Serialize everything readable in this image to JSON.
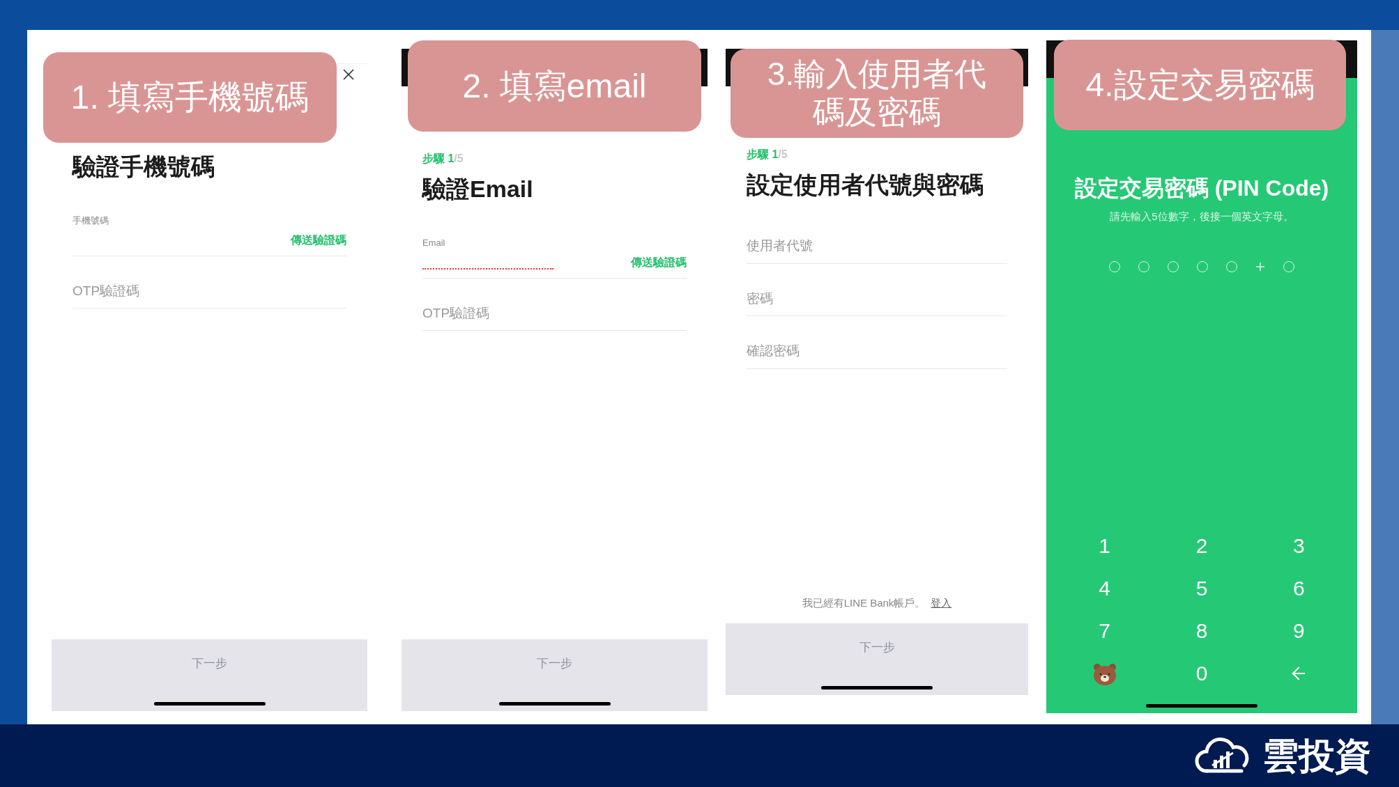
{
  "panels": [
    {
      "kind": "form",
      "caption": "1. 填寫手機號碼",
      "dark_top_bar": false,
      "closable": true,
      "title": "驗證手機號碼",
      "fields": [
        {
          "label": "手機號碼",
          "action": "傳送驗證碼",
          "redacted": false
        },
        {
          "placeholder": "OTP驗證碼"
        }
      ],
      "next_button": "下一步"
    },
    {
      "kind": "form",
      "caption": "2. 填寫email",
      "dark_top_bar": true,
      "closable": false,
      "step": {
        "current": "步驟 1",
        "total": "/5"
      },
      "title": "驗證Email",
      "fields": [
        {
          "label": "Email",
          "action": "傳送驗證碼",
          "redacted": true
        },
        {
          "placeholder": "OTP驗證碼"
        }
      ],
      "next_button": "下一步"
    },
    {
      "kind": "form",
      "caption": "3.輸入使用者代碼及密碼",
      "dark_top_bar": true,
      "closable": false,
      "step": {
        "current": "步驟 1",
        "total": "/5"
      },
      "title": "設定使用者代號與密碼",
      "fields": [
        {
          "placeholder": "使用者代號"
        },
        {
          "placeholder": "密碼"
        },
        {
          "placeholder": "確認密碼"
        }
      ],
      "footer_note": {
        "text": "我已經有LINE Bank帳戶。",
        "link": "登入"
      },
      "next_button": "下一步"
    },
    {
      "kind": "pin",
      "caption": "4.設定交易密碼",
      "dark_top_bar": true,
      "title": "設定交易密碼 (PIN Code)",
      "hint": "請先輸入5位數字，後接一個英文字母。",
      "pin_slots": [
        {
          "kind": "circle"
        },
        {
          "kind": "circle"
        },
        {
          "kind": "circle"
        },
        {
          "kind": "circle"
        },
        {
          "kind": "circle"
        },
        {
          "kind": "plus"
        },
        {
          "kind": "circle"
        }
      ],
      "keys": [
        {
          "kind": "digit",
          "label": "1"
        },
        {
          "kind": "digit",
          "label": "2"
        },
        {
          "kind": "digit",
          "label": "3"
        },
        {
          "kind": "digit",
          "label": "4"
        },
        {
          "kind": "digit",
          "label": "5"
        },
        {
          "kind": "digit",
          "label": "6"
        },
        {
          "kind": "digit",
          "label": "7"
        },
        {
          "kind": "digit",
          "label": "8"
        },
        {
          "kind": "digit",
          "label": "9"
        },
        {
          "kind": "bear"
        },
        {
          "kind": "digit",
          "label": "0"
        },
        {
          "kind": "backspace"
        }
      ]
    }
  ],
  "brand": {
    "name": "雲投資"
  }
}
